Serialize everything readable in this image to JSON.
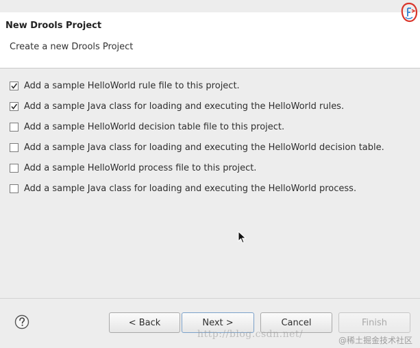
{
  "window": {
    "title": "New Drools Project",
    "description": "Create a new Drools Project"
  },
  "options": [
    {
      "label": "Add a sample HelloWorld rule file to this project.",
      "checked": true
    },
    {
      "label": "Add a sample Java class for loading and executing the HelloWorld rules.",
      "checked": true
    },
    {
      "label": "Add a sample HelloWorld decision table file to this project.",
      "checked": false
    },
    {
      "label": "Add a sample Java class for loading and executing the HelloWorld decision table.",
      "checked": false
    },
    {
      "label": "Add a sample HelloWorld process file to this project.",
      "checked": false
    },
    {
      "label": "Add a sample Java class for loading and executing the HelloWorld process.",
      "checked": false
    }
  ],
  "buttons": {
    "back": "< Back",
    "next": "Next >",
    "cancel": "Cancel",
    "finish": "Finish"
  },
  "buttons_state": {
    "finish_enabled": false,
    "default_button": "next"
  },
  "icons": {
    "logo": "drools-logo-icon",
    "help": "help-icon",
    "checkbox": "checkmark-icon",
    "pointer": "mouse-pointer-icon"
  },
  "watermark": {
    "url": "http://blog.csdn.net/",
    "site": "@稀土掘金技术社区"
  },
  "colors": {
    "background": "#ededed",
    "header_background": "#ffffff",
    "default_button_border": "#7aa0c9",
    "logo_red": "#d9352b",
    "logo_blue": "#2f7fd0"
  }
}
